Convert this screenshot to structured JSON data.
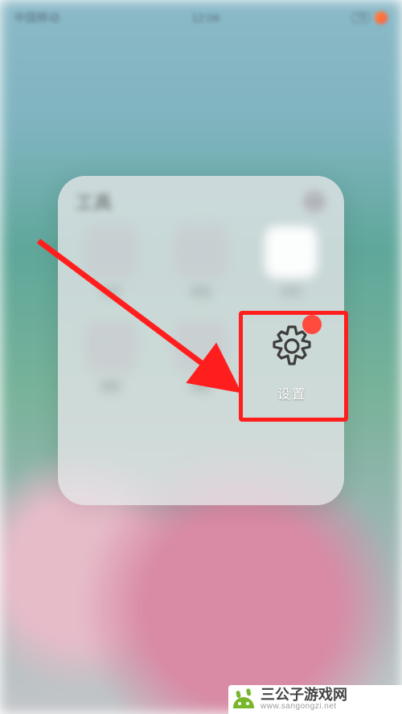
{
  "status_bar": {
    "left": "中国移动",
    "center": "12:06",
    "battery": "78"
  },
  "folder": {
    "title": "工具",
    "more_label": "⋯",
    "apps": [
      {
        "label": "文件",
        "icon": "files-icon"
      },
      {
        "label": "录音",
        "icon": "recorder-icon"
      },
      {
        "label": "互传",
        "icon": "transfer-icon"
      },
      {
        "label": "便签",
        "icon": "notes-icon"
      },
      {
        "label": "相册",
        "icon": "gallery-icon"
      },
      {
        "label": "设置",
        "icon": "gear-icon"
      }
    ]
  },
  "highlight": {
    "label": "设置",
    "icon": "gear-icon"
  },
  "annotation": {
    "box_color": "#ff1e1e",
    "arrow_color": "#ff1e1e"
  },
  "watermark": {
    "text": "三公子游戏网",
    "domain": "www.sangongzi.net"
  }
}
